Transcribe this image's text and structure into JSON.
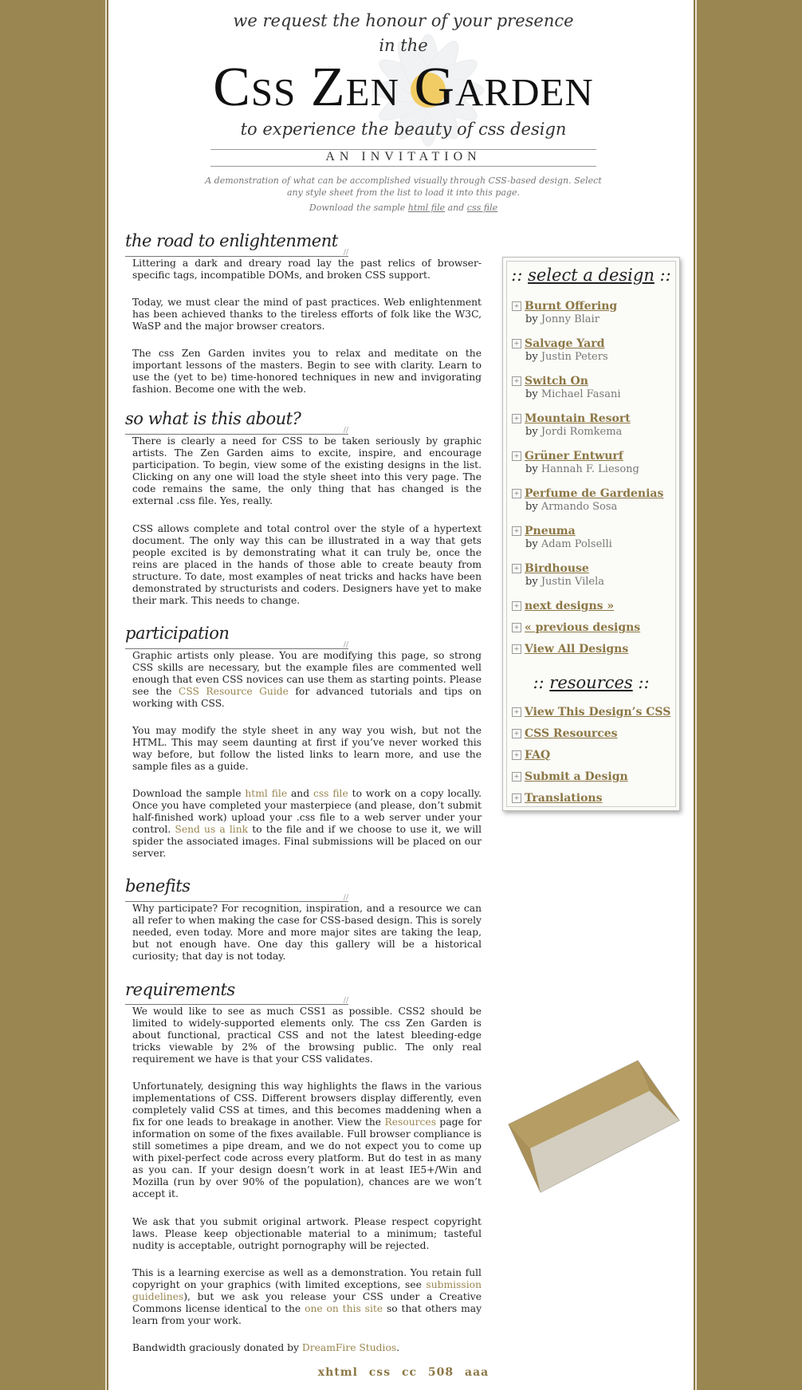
{
  "header": {
    "line1": "we request the honour of your presence",
    "line2": "in the",
    "title": "Css Zen Garden",
    "line3": "to experience the beauty of css design",
    "invitation": "AN INVITATION",
    "summary": "A demonstration of what can be accomplished visually through CSS-based design. Select any style sheet from the list to load it into this page.",
    "download_prefix": "Download the sample ",
    "html_file": "html file",
    "and": " and ",
    "css_file": "css file"
  },
  "sections": {
    "road": {
      "heading": "the road to enlightenment",
      "p1": "Littering a dark and dreary road lay the past relics of browser-specific tags, incompatible DOMs, and broken CSS support.",
      "p2": "Today, we must clear the mind of past practices. Web enlightenment has been achieved thanks to the tireless efforts of folk like the W3C, WaSP and the major browser creators.",
      "p3": "The css Zen Garden invites you to relax and meditate on the important lessons of the masters. Begin to see with clarity. Learn to use the (yet to be) time-honored techniques in new and invigorating fashion. Become one with the web."
    },
    "about": {
      "heading": "so what is this about?",
      "p1": "There is clearly a need for CSS to be taken seriously by graphic artists. The Zen Garden aims to excite, inspire, and encourage participation. To begin, view some of the existing designs in the list. Clicking on any one will load the style sheet into this very page. The code remains the same, the only thing that has changed is the external .css file. Yes, really.",
      "p2": "CSS allows complete and total control over the style of a hypertext document. The only way this can be illustrated in a way that gets people excited is by demonstrating what it can truly be, once the reins are placed in the hands of those able to create beauty from structure. To date, most examples of neat tricks and hacks have been demonstrated by structurists and coders. Designers have yet to make their mark. This needs to change."
    },
    "participation": {
      "heading": "participation",
      "p1a": "Graphic artists only please. You are modifying this page, so strong CSS skills are necessary, but the example files are commented well enough that even CSS novices can use them as starting points. Please see the ",
      "p1_link": "CSS Resource Guide",
      "p1b": " for advanced tutorials and tips on working with CSS.",
      "p2": "You may modify the style sheet in any way you wish, but not the HTML. This may seem daunting at first if you’ve never worked this way before, but follow the listed links to learn more, and use the sample files as a guide.",
      "p3a": "Download the sample ",
      "p3_html": "html file",
      "p3_and": " and ",
      "p3_css": "css file",
      "p3b": " to work on a copy locally. Once you have completed your masterpiece (and please, don’t submit half-finished work) upload your .css file to a web server under your control. ",
      "p3_link": "Send us a link",
      "p3c": " to the file and if we choose to use it, we will spider the associated images. Final submissions will be placed on our server."
    },
    "benefits": {
      "heading": "benefits",
      "p1": "Why participate? For recognition, inspiration, and a resource we can all refer to when making the case for CSS-based design. This is sorely needed, even today. More and more major sites are taking the leap, but not enough have. One day this gallery will be a historical curiosity; that day is not today."
    },
    "requirements": {
      "heading": "requirements",
      "p1": "We would like to see as much CSS1 as possible. CSS2 should be limited to widely-supported elements only. The css Zen Garden is about functional, practical CSS and not the latest bleeding-edge tricks viewable by 2% of the browsing public. The only real requirement we have is that your CSS validates.",
      "p2a": "Unfortunately, designing this way highlights the flaws in the various implementations of CSS. Different browsers display differently, even completely valid CSS at times, and this becomes maddening when a fix for one leads to breakage in another. View the ",
      "p2_link": "Resources",
      "p2b": " page for information on some of the fixes available. Full browser compliance is still sometimes a pipe dream, and we do not expect you to come up with pixel-perfect code across every platform. But do test in as many as you can. If your design doesn’t work in at least IE5+/Win and Mozilla (run by over 90% of the population), chances are we won’t accept it.",
      "p3": "We ask that you submit original artwork. Please respect copyright laws. Please keep objectionable material to a minimum; tasteful nudity is acceptable, outright pornography will be rejected.",
      "p4a": "This is a learning exercise as well as a demonstration. You retain full copyright on your graphics (with limited exceptions, see ",
      "p4_link1": "submission guidelines",
      "p4b": "), but we ask you release your CSS under a Creative Commons license identical to the ",
      "p4_link2": "one on this site",
      "p4c": " so that others may learn from your work.",
      "p5a": "Bandwidth graciously donated by ",
      "p5_link": "DreamFire Studios",
      "p5b": "."
    }
  },
  "sidebar": {
    "select_heading_pre": ":: ",
    "select_heading": "select a design",
    "select_heading_post": " ::",
    "designs": [
      {
        "name": "Burnt Offering",
        "by": "by ",
        "author": "Jonny Blair"
      },
      {
        "name": "Salvage Yard",
        "by": "by ",
        "author": "Justin Peters"
      },
      {
        "name": "Switch On",
        "by": "by ",
        "author": "Michael Fasani"
      },
      {
        "name": "Mountain Resort",
        "by": "by ",
        "author": "Jordi Romkema"
      },
      {
        "name": "Grüner Entwurf",
        "by": "by ",
        "author": "Hannah F. Liesong"
      },
      {
        "name": "Perfume de Gardenias",
        "by": "by ",
        "author": "Armando Sosa"
      },
      {
        "name": "Pneuma",
        "by": "by ",
        "author": "Adam Polselli"
      },
      {
        "name": "Birdhouse",
        "by": "by ",
        "author": "Justin Vilela"
      }
    ],
    "nav": [
      "next designs »",
      "« previous designs",
      "View All Designs"
    ],
    "resources_heading_pre": ":: ",
    "resources_heading": "resources",
    "resources_heading_post": " ::",
    "resources": [
      "View This Design’s CSS",
      "CSS Resources",
      "FAQ",
      "Submit a Design",
      "Translations"
    ],
    "bullet": "+"
  },
  "footer": {
    "links": [
      "xhtml",
      "css",
      "cc",
      "508",
      "aaa"
    ]
  }
}
